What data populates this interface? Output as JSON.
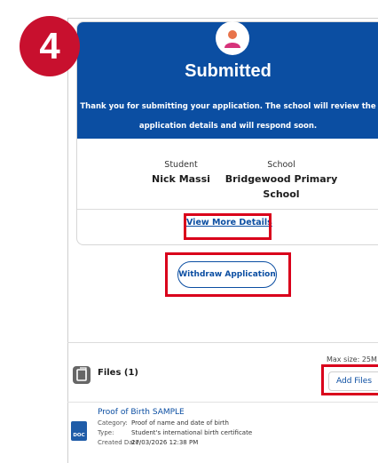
{
  "step_number": "4",
  "status": {
    "title": "Submitted",
    "message_line1": "Thank you for submitting your application. The school will review the",
    "message_line2": "application details and will respond soon."
  },
  "details": {
    "student_label": "Student",
    "student_value": "Nick Massi",
    "school_label": "School",
    "school_value_line1": "Bridgewood Primary",
    "school_value_line2": "School"
  },
  "view_more_label": "View More Details",
  "withdraw_label": "Withdraw Application",
  "files": {
    "title": "Files (1)",
    "max_size": "Max size: 25M",
    "add_label": "Add Files",
    "items": [
      {
        "name": "Proof of Birth SAMPLE",
        "icon_text": "DOC",
        "category_label": "Category:",
        "category": "Proof of name and date of birth",
        "type_label": "Type:",
        "type": "Student's international birth certificate",
        "created_label": "Created Date:",
        "created": "27/03/2026 12:38 PM"
      }
    ]
  },
  "colors": {
    "brand_blue": "#0b4ea2",
    "highlight_red": "#d9001b",
    "badge_red": "#c8102e"
  }
}
